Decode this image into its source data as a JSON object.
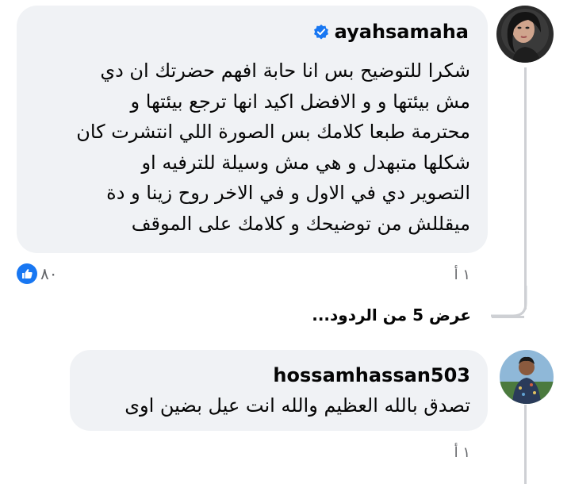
{
  "comments": [
    {
      "author": "ayahsamaha",
      "verified": true,
      "text_lines": [
        "شكرا للتوضيح بس انا حابة افهم حضرتك ان دي",
        "مش بيئتها و و الافضل اكيد انها ترجع بيئتها و",
        "محترمة طبعا كلامك بس الصورة اللي انتشرت كان",
        "شكلها متبهدل و هي مش وسيلة للترفيه او",
        "التصوير دي في الاول و في الاخر روح زينا و دة",
        "ميقللش من توضيحك و كلامك على الموقف"
      ],
      "timestamp": "١ أ",
      "reaction_count": "٨٠"
    },
    {
      "author": "hossamhassan503",
      "verified": false,
      "text_lines": [
        "تصدق بالله العظيم والله انت عيل بضين اوى"
      ],
      "timestamp": "١ أ"
    }
  ],
  "view_replies": "عرض 5 من الردود...",
  "colors": {
    "bubble": "#f0f2f5",
    "verified": "#1877f2",
    "like": "#1877f2",
    "meta": "#65676b",
    "thread_line": "#ced0d4"
  },
  "icons": {
    "verified": "verified-badge-icon",
    "like": "like-thumb-icon"
  }
}
